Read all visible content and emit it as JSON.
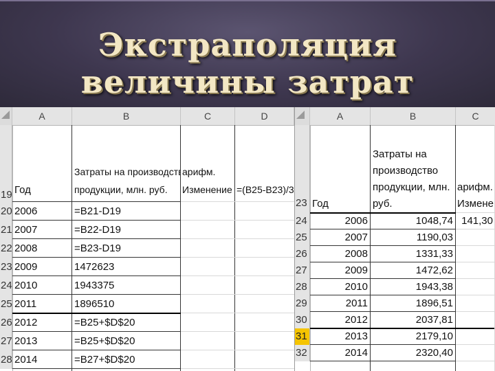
{
  "slide": {
    "title": "Экстраполяция величины затрат"
  },
  "left_sheet": {
    "columns": [
      "A",
      "B",
      "C",
      "D"
    ],
    "header_row": {
      "row": "19",
      "a": "Год",
      "b_line1": "Затраты на производство",
      "b_line2": "продукции, млн. руб.",
      "c_line1": "арифм.",
      "c_line2": "Изменение",
      "d": "=(B25-B23)/3"
    },
    "rows": [
      {
        "row": "20",
        "a": "2006",
        "b": "=B21-D19"
      },
      {
        "row": "21",
        "a": "2007",
        "b": "=B22-D19"
      },
      {
        "row": "22",
        "a": "2008",
        "b": "=B23-D19"
      },
      {
        "row": "23",
        "a": "2009",
        "b": "1472623"
      },
      {
        "row": "24",
        "a": "2010",
        "b": "1943375"
      },
      {
        "row": "25",
        "a": "2011",
        "b": "1896510"
      },
      {
        "row": "26",
        "a": "2012",
        "b": "=B25+$D$20"
      },
      {
        "row": "27",
        "a": "2013",
        "b": "=B25+$D$20"
      },
      {
        "row": "28",
        "a": "2014",
        "b": "=B27+$D$20"
      }
    ]
  },
  "right_sheet": {
    "columns": [
      "A",
      "B",
      "C"
    ],
    "header_row": {
      "row": "23",
      "a": "Год",
      "b_line1": "Затраты на",
      "b_line2": "производство",
      "b_line3": "продукции, млн.",
      "b_line4": "руб.",
      "c_line1": "арифм.",
      "c_line2": "Изменение"
    },
    "rows": [
      {
        "row": "24",
        "a": "2006",
        "b": "1048,74",
        "c": "141,30"
      },
      {
        "row": "25",
        "a": "2007",
        "b": "1190,03",
        "c": ""
      },
      {
        "row": "26",
        "a": "2008",
        "b": "1331,33",
        "c": ""
      },
      {
        "row": "27",
        "a": "2009",
        "b": "1472,62",
        "c": ""
      },
      {
        "row": "28",
        "a": "2010",
        "b": "1943,38",
        "c": ""
      },
      {
        "row": "29",
        "a": "2011",
        "b": "1896,51",
        "c": ""
      },
      {
        "row": "30",
        "a": "2012",
        "b": "2037,81",
        "c": ""
      },
      {
        "row": "31",
        "a": "2013",
        "b": "2179,10",
        "c": ""
      },
      {
        "row": "32",
        "a": "2014",
        "b": "2320,40",
        "c": ""
      }
    ],
    "selected_row": "31"
  },
  "colors": {
    "banner": "#3e374f",
    "title_text": "#f3e7c4",
    "header_bg": "#e4e4e4",
    "selected_row_header": "#f5c400"
  }
}
